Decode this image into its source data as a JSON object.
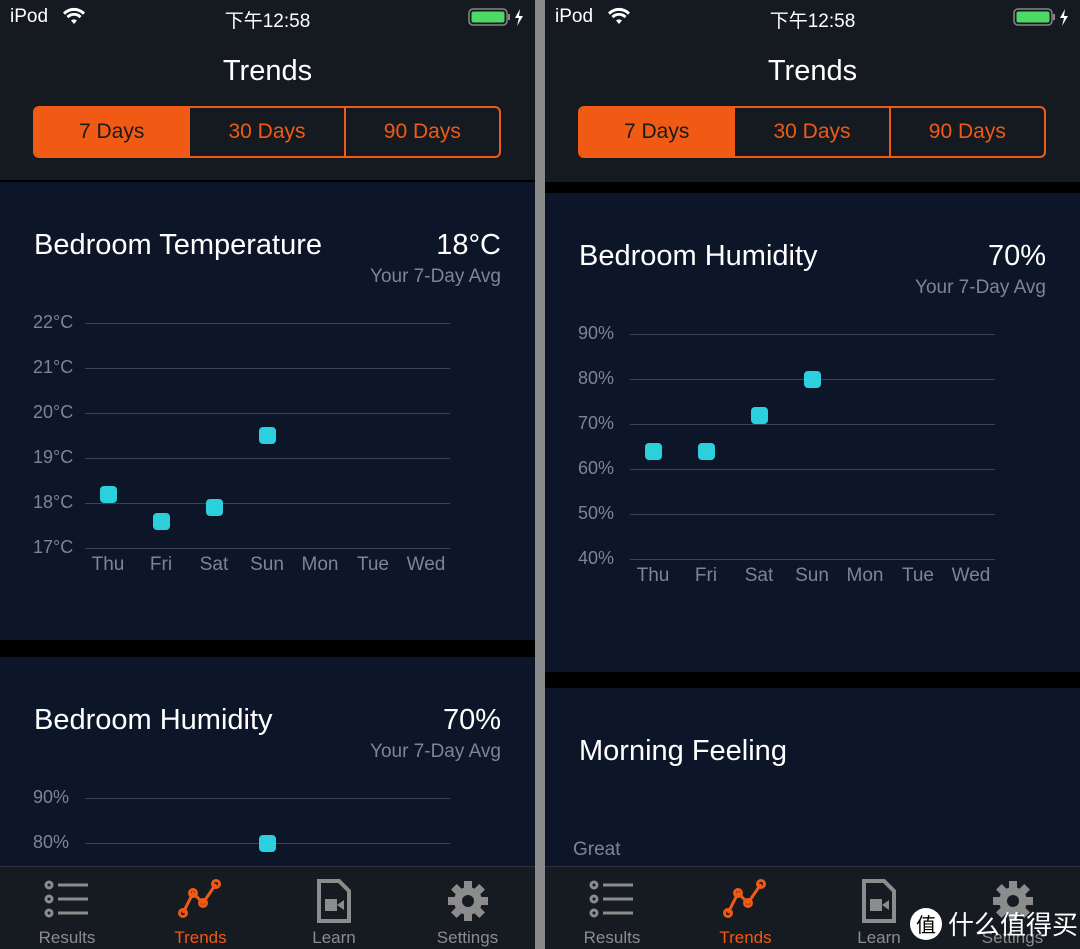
{
  "status": {
    "carrier": "iPod",
    "time": "下午12:58",
    "battery_color": "#4cd964"
  },
  "nav_title": "Trends",
  "segments": [
    "7 Days",
    "30 Days",
    "90 Days"
  ],
  "selected_segment": "7 Days",
  "accent": "#f05a14",
  "point_color": "#2ccfdc",
  "tabs": [
    {
      "label": "Results",
      "icon": "list-icon"
    },
    {
      "label": "Trends",
      "icon": "trend-line-icon",
      "active": true
    },
    {
      "label": "Learn",
      "icon": "video-document-icon"
    },
    {
      "label": "Settings",
      "icon": "gear-icon"
    }
  ],
  "watermark": {
    "logo": "值",
    "text": "什么值得买"
  },
  "screens": [
    {
      "cards": [
        {
          "title": "Bedroom Temperature",
          "value": "18°C",
          "subtitle": "Your 7-Day Avg"
        },
        {
          "title": "Bedroom Humidity",
          "value": "70%",
          "subtitle": "Your 7-Day Avg"
        }
      ]
    },
    {
      "cards": [
        {
          "title": "Bedroom Humidity",
          "value": "70%",
          "subtitle": "Your 7-Day Avg"
        },
        {
          "title": "Morning Feeling",
          "first_label": "Great"
        }
      ]
    }
  ],
  "chart_data": [
    {
      "type": "scatter",
      "title": "Bedroom Temperature",
      "categories": [
        "Thu",
        "Fri",
        "Sat",
        "Sun",
        "Mon",
        "Tue",
        "Wed"
      ],
      "yticks": [
        "22°C",
        "21°C",
        "20°C",
        "19°C",
        "18°C",
        "17°C"
      ],
      "ylim": [
        17,
        22
      ],
      "values": [
        18.2,
        17.6,
        17.9,
        19.5,
        null,
        null,
        null
      ],
      "grid": true
    },
    {
      "type": "scatter",
      "title": "Bedroom Humidity",
      "categories": [
        "Thu",
        "Fri",
        "Sat",
        "Sun",
        "Mon",
        "Tue",
        "Wed"
      ],
      "yticks": [
        "90%",
        "80%",
        "70%",
        "60%",
        "50%",
        "40%"
      ],
      "ylim": [
        40,
        90
      ],
      "values": [
        64,
        64,
        72,
        80,
        null,
        null,
        null
      ],
      "grid": true
    }
  ]
}
